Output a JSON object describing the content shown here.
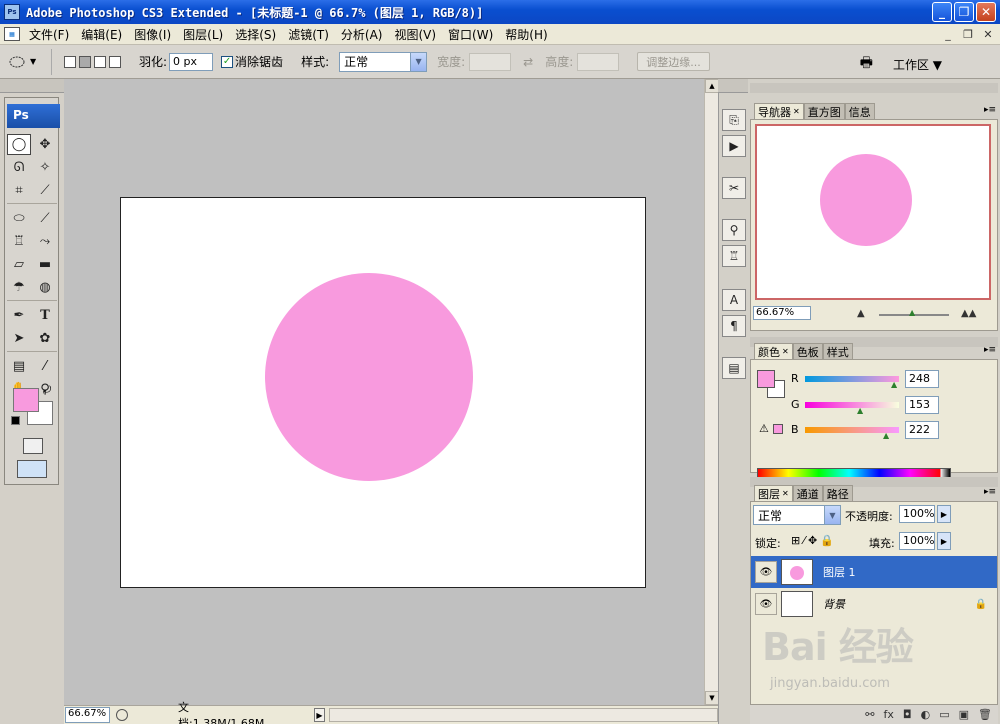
{
  "window": {
    "icon": "Ps",
    "title": "Adobe Photoshop CS3 Extended - [未标题-1 @ 66.7% (图层 1, RGB/8)]",
    "min": "_",
    "max": "❐",
    "close": "✕"
  },
  "menu": {
    "items": [
      "文件(F)",
      "编辑(E)",
      "图像(I)",
      "图层(L)",
      "选择(S)",
      "滤镜(T)",
      "分析(A)",
      "视图(V)",
      "窗口(W)",
      "帮助(H)"
    ]
  },
  "options": {
    "feather_label": "羽化:",
    "feather_value": "0 px",
    "antialias_checked": "✓",
    "antialias_label": "消除锯齿",
    "style_label": "样式:",
    "style_value": "正常",
    "width_label": "宽度:",
    "height_label": "高度:",
    "refine_label": "调整边缘...",
    "workspace_label": "工作区 ▼"
  },
  "toolbox": {
    "badge": "Ps"
  },
  "canvas": {
    "circle_color": "#f89ade",
    "doc_bg": "#ffffff"
  },
  "status": {
    "zoom": "66.67%",
    "doc_info": "文档:1.38M/1.68M"
  },
  "navigator": {
    "tabs": [
      "导航器",
      "直方图",
      "信息"
    ],
    "zoom": "66.67%"
  },
  "color": {
    "tabs": [
      "颜色",
      "色板",
      "样式"
    ],
    "channels": [
      {
        "name": "R",
        "value": "248"
      },
      {
        "name": "G",
        "value": "153"
      },
      {
        "name": "B",
        "value": "222"
      }
    ],
    "foreground": "#f89ade"
  },
  "layers": {
    "tabs": [
      "图层",
      "通道",
      "路径"
    ],
    "blend_mode": "正常",
    "opacity_label": "不透明度:",
    "opacity_value": "100%",
    "lock_label": "锁定:",
    "fill_label": "填充:",
    "fill_value": "100%",
    "items": [
      {
        "name": "图层 1",
        "selected": true
      },
      {
        "name": "背景",
        "selected": false
      }
    ]
  },
  "watermark": {
    "text": "Bai 经验",
    "url": "jingyan.baidu.com"
  }
}
